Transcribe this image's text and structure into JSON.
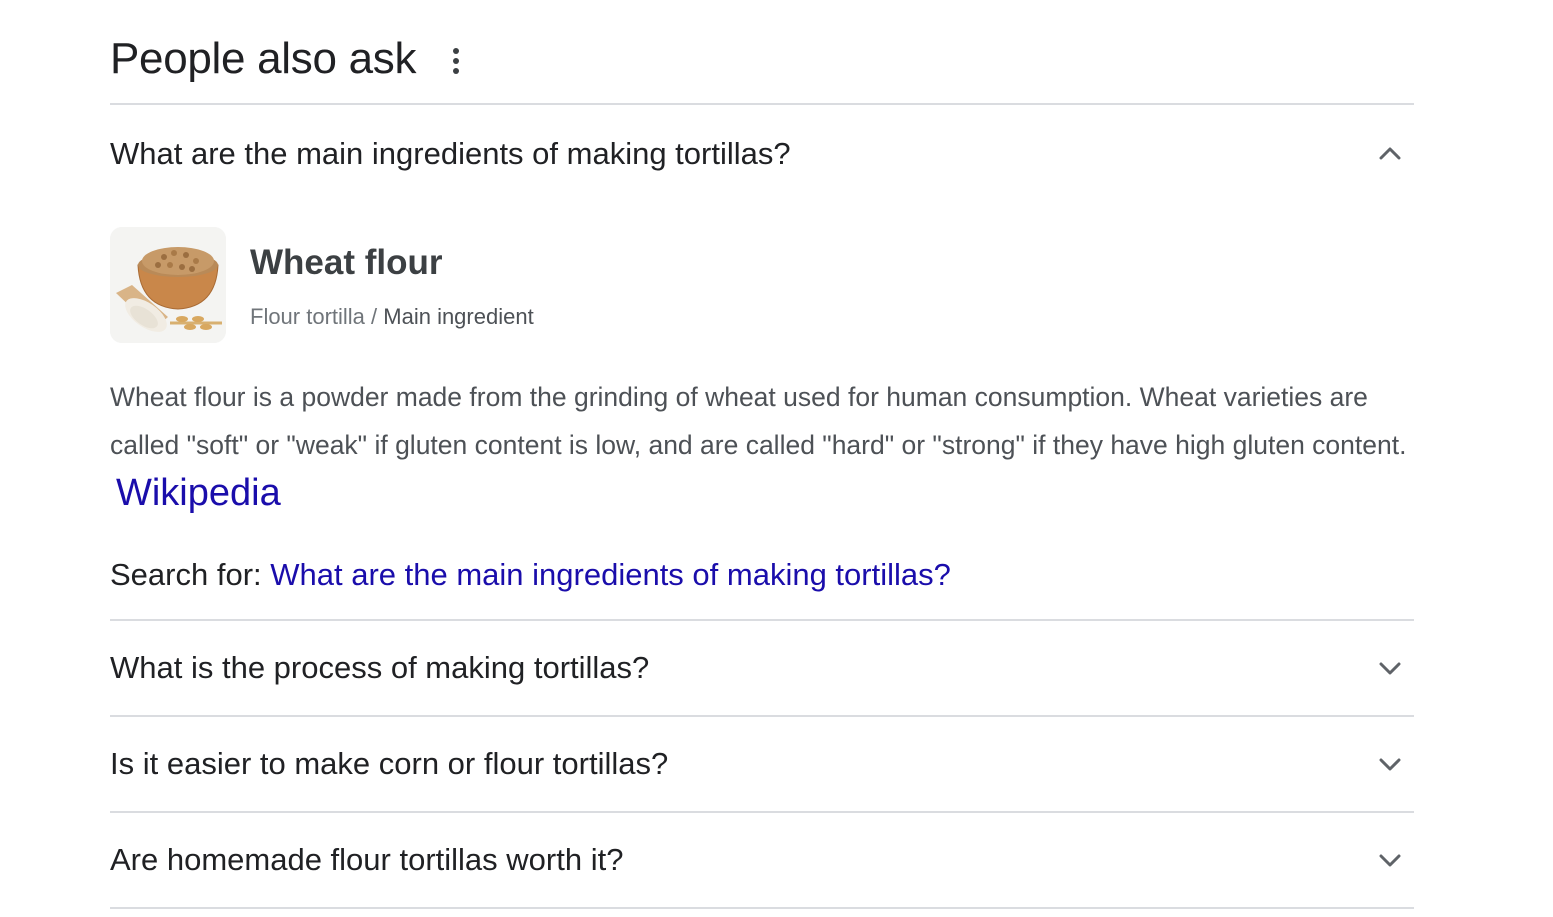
{
  "header": {
    "title": "People also ask",
    "more_icon": "more-vert-icon"
  },
  "questions": [
    {
      "text": "What are the main ingredients of making tortillas?",
      "expanded": true,
      "chevron": "chevron-up-icon",
      "answer": {
        "image_icon": "wheat-flour-bowl-image",
        "title": "Wheat flour",
        "subtitle_prefix": "Flour tortilla / ",
        "subtitle_main": "Main ingredient",
        "body": "Wheat flour is a powder made from the grinding of wheat used for human consumption. Wheat varieties are called \"soft\" or \"weak\" if gluten content is low, and are called \"hard\" or \"strong\" if they have high gluten content.",
        "source_link": "Wikipedia",
        "search_for_label": "Search for: ",
        "search_for_link": "What are the main ingredients of making tortillas?"
      }
    },
    {
      "text": "What is the process of making tortillas?",
      "expanded": false,
      "chevron": "chevron-down-icon"
    },
    {
      "text": "Is it easier to make corn or flour tortillas?",
      "expanded": false,
      "chevron": "chevron-down-icon"
    },
    {
      "text": "Are homemade flour tortillas worth it?",
      "expanded": false,
      "chevron": "chevron-down-icon"
    }
  ],
  "colors": {
    "text": "#202124",
    "secondary": "#4d5156",
    "link": "#1a0dab",
    "divider": "#dadce0"
  }
}
